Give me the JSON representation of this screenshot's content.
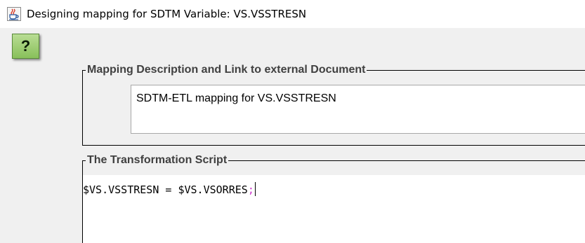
{
  "window": {
    "title": "Designing mapping for SDTM Variable: VS.VSSTRESN",
    "icon": "java-cup-icon"
  },
  "help_button": {
    "label": "?",
    "color": "#9ccd6f"
  },
  "description_group": {
    "legend": "Mapping Description and Link to external Document",
    "value": "SDTM-ETL mapping for VS.VSSTRESN"
  },
  "script_group": {
    "legend": "The Transformation Script",
    "script": {
      "code": "$VS.VSSTRESN = $VS.VSORRES",
      "terminator": ";",
      "terminator_color": "#cc33cc"
    }
  }
}
